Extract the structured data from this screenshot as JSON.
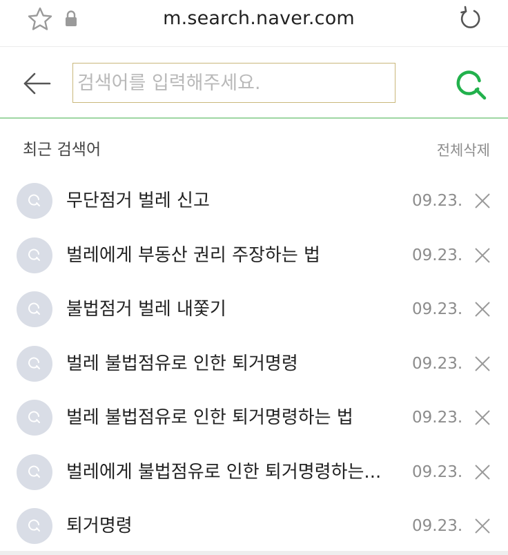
{
  "browser": {
    "url": "m.search.naver.com",
    "icons": [
      "star-icon",
      "lock-icon",
      "reload-icon"
    ]
  },
  "search": {
    "placeholder": "검색어를 입력해주세요.",
    "value": "",
    "accent_color": "#22b14c"
  },
  "recent": {
    "title": "최근 검색어",
    "delete_all_label": "전체삭제",
    "items": [
      {
        "keyword": "무단점거 벌레 신고",
        "date": "09.23."
      },
      {
        "keyword": "벌레에게 부동산 권리 주장하는 법",
        "date": "09.23."
      },
      {
        "keyword": "불법점거 벌레 내쫓기",
        "date": "09.23."
      },
      {
        "keyword": "벌레 불법점유로 인한 퇴거명령",
        "date": "09.23."
      },
      {
        "keyword": "벌레 불법점유로 인한 퇴거명령하는 법",
        "date": "09.23."
      },
      {
        "keyword": "벌레에게 불법점유로 인한 퇴거명령하는...",
        "date": "09.23."
      },
      {
        "keyword": "퇴거명령",
        "date": "09.23."
      }
    ]
  }
}
